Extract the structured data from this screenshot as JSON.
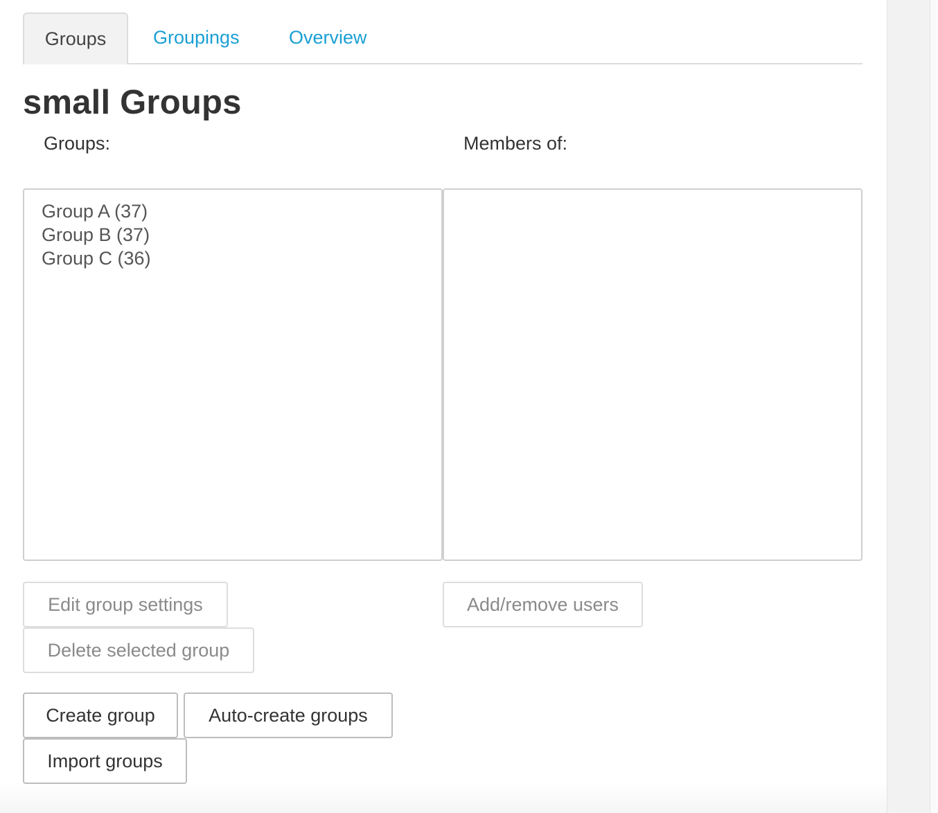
{
  "tabs": [
    {
      "label": "Groups",
      "active": true
    },
    {
      "label": "Groupings",
      "active": false
    },
    {
      "label": "Overview",
      "active": false
    }
  ],
  "page_title": "small Groups",
  "groups_panel": {
    "label": "Groups:",
    "options": [
      "Group A (37)",
      "Group B (37)",
      "Group C (36)"
    ]
  },
  "members_panel": {
    "label": "Members of:"
  },
  "buttons": {
    "edit_group_settings": "Edit group settings",
    "delete_selected_group": "Delete selected group",
    "add_remove_users": "Add/remove users",
    "create_group": "Create group",
    "auto_create_groups": "Auto-create groups",
    "import_groups": "Import groups"
  },
  "colors": {
    "link": "#1a9fd3",
    "active_tab_bg": "#f2f2f2",
    "border": "#cccccc"
  }
}
